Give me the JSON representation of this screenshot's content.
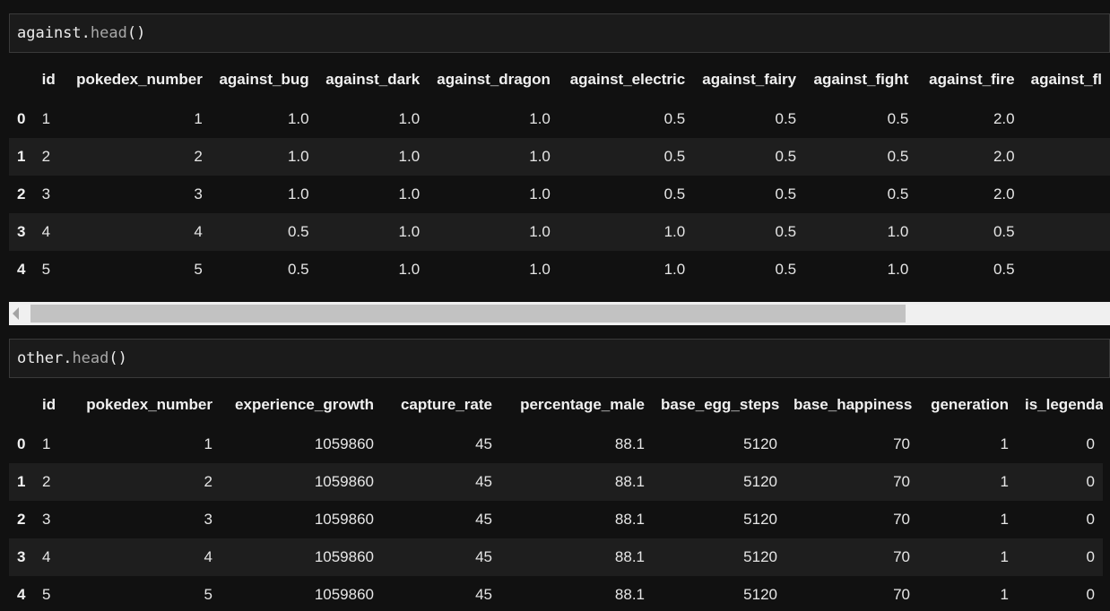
{
  "cell1": {
    "object": "against",
    "method": "head",
    "parens": "()"
  },
  "table1": {
    "columns": [
      "",
      "id",
      "pokedex_number",
      "against_bug",
      "against_dark",
      "against_dragon",
      "against_electric",
      "against_fairy",
      "against_fight",
      "against_fire",
      "against_fl"
    ],
    "rows": [
      {
        "index": "0",
        "cells": [
          "1",
          "1",
          "1.0",
          "1.0",
          "1.0",
          "0.5",
          "0.5",
          "0.5",
          "2.0",
          ""
        ]
      },
      {
        "index": "1",
        "cells": [
          "2",
          "2",
          "1.0",
          "1.0",
          "1.0",
          "0.5",
          "0.5",
          "0.5",
          "2.0",
          ""
        ]
      },
      {
        "index": "2",
        "cells": [
          "3",
          "3",
          "1.0",
          "1.0",
          "1.0",
          "0.5",
          "0.5",
          "0.5",
          "2.0",
          ""
        ]
      },
      {
        "index": "3",
        "cells": [
          "4",
          "4",
          "0.5",
          "1.0",
          "1.0",
          "1.0",
          "0.5",
          "1.0",
          "0.5",
          ""
        ]
      },
      {
        "index": "4",
        "cells": [
          "5",
          "5",
          "0.5",
          "1.0",
          "1.0",
          "1.0",
          "0.5",
          "1.0",
          "0.5",
          ""
        ]
      }
    ]
  },
  "cell2": {
    "object": "other",
    "method": "head",
    "parens": "()"
  },
  "table2": {
    "columns": [
      "",
      "id",
      "pokedex_number",
      "experience_growth",
      "capture_rate",
      "percentage_male",
      "base_egg_steps",
      "base_happiness",
      "generation",
      "is_legendary"
    ],
    "rows": [
      {
        "index": "0",
        "cells": [
          "1",
          "1",
          "1059860",
          "45",
          "88.1",
          "5120",
          "70",
          "1",
          "0"
        ]
      },
      {
        "index": "1",
        "cells": [
          "2",
          "2",
          "1059860",
          "45",
          "88.1",
          "5120",
          "70",
          "1",
          "0"
        ]
      },
      {
        "index": "2",
        "cells": [
          "3",
          "3",
          "1059860",
          "45",
          "88.1",
          "5120",
          "70",
          "1",
          "0"
        ]
      },
      {
        "index": "3",
        "cells": [
          "4",
          "4",
          "1059860",
          "45",
          "88.1",
          "5120",
          "70",
          "1",
          "0"
        ]
      },
      {
        "index": "4",
        "cells": [
          "5",
          "5",
          "1059860",
          "45",
          "88.1",
          "5120",
          "70",
          "1",
          "0"
        ]
      }
    ]
  },
  "colors": {
    "background": "#111111",
    "row_stripe": "#1e1e1e",
    "cell_border": "#3a3a3a"
  }
}
